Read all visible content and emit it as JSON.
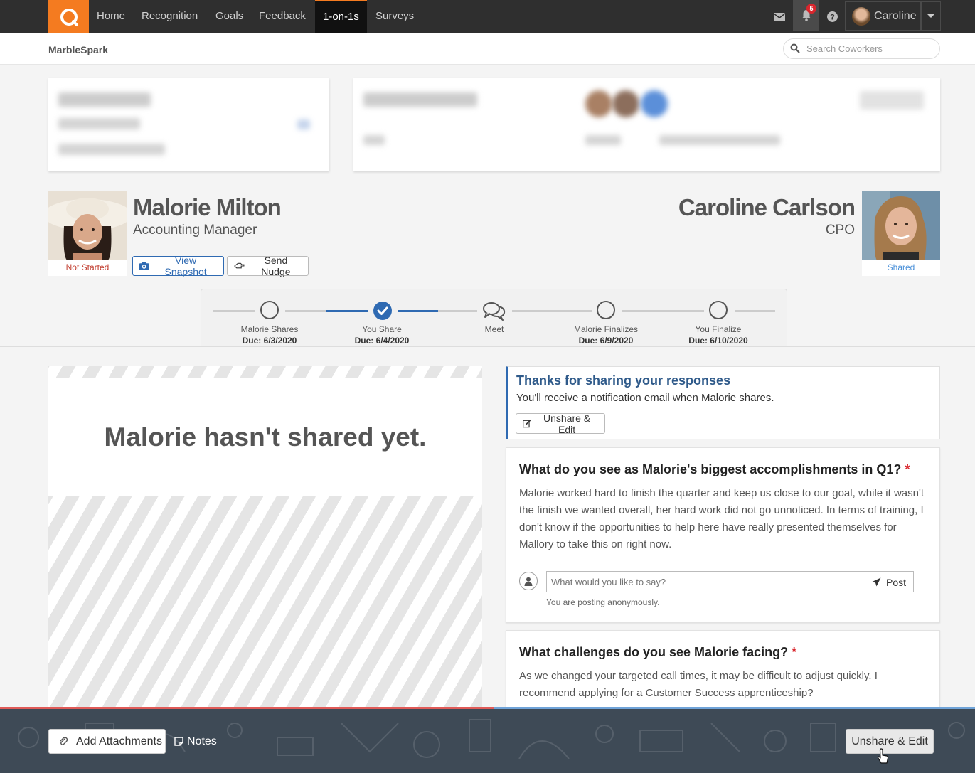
{
  "nav": {
    "items": [
      {
        "label": "Home",
        "active": false
      },
      {
        "label": "Recognition",
        "active": false
      },
      {
        "label": "Goals",
        "active": false
      },
      {
        "label": "Feedback",
        "active": false
      },
      {
        "label": "1-on-1s",
        "active": true
      },
      {
        "label": "Surveys",
        "active": false
      }
    ],
    "notification_count": "5",
    "user_name": "Caroline",
    "accent_color": "#f47b20"
  },
  "subheader": {
    "brand": "MarbleSpark",
    "search_placeholder": "Search Coworkers"
  },
  "employee": {
    "name": "Malorie Milton",
    "title": "Accounting Manager",
    "status": "Not Started",
    "status_color": "#c0392b",
    "view_snapshot_label": "View Snapshot",
    "send_nudge_label": "Send Nudge"
  },
  "manager": {
    "name": "Caroline Carlson",
    "title": "CPO",
    "status": "Shared",
    "status_color": "#4a90d9"
  },
  "steps": [
    {
      "label": "Malorie Shares",
      "due": "Due: 6/3/2020",
      "state": "pending"
    },
    {
      "label": "You Share",
      "due": "Due: 6/4/2020",
      "state": "done"
    },
    {
      "label": "Meet",
      "due": "",
      "state": "meet"
    },
    {
      "label": "Malorie Finalizes",
      "due": "Due: 6/9/2020",
      "state": "pending"
    },
    {
      "label": "You Finalize",
      "due": "Due: 6/10/2020",
      "state": "pending"
    }
  ],
  "left_panel": {
    "message": "Malorie hasn't shared yet."
  },
  "alert": {
    "title": "Thanks for sharing your responses",
    "text": "You'll receive a notification email when Malorie shares.",
    "button_label": "Unshare & Edit"
  },
  "questions": [
    {
      "title": "What do you see as Malorie's biggest accomplishments in Q1?",
      "required": "*",
      "answer": "Malorie worked hard to finish the quarter and keep us close to our goal, while it wasn't the finish we wanted overall, her hard work did not go unnoticed. In terms of training, I don't know if the opportunities to help here have really presented themselves for Mallory to take this on right now.",
      "comment_placeholder": "What would you like to say?",
      "post_label": "Post",
      "anon_note": "You are posting anonymously."
    },
    {
      "title": "What challenges do you see Malorie facing?",
      "required": "*",
      "answer": "As we changed your targeted call times, it may be difficult to adjust quickly. I recommend applying for a Customer Success apprenticeship?"
    }
  ],
  "bottom_bar": {
    "add_attachments_label": "Add Attachments",
    "notes_label": "Notes",
    "unshare_label": "Unshare & Edit"
  }
}
